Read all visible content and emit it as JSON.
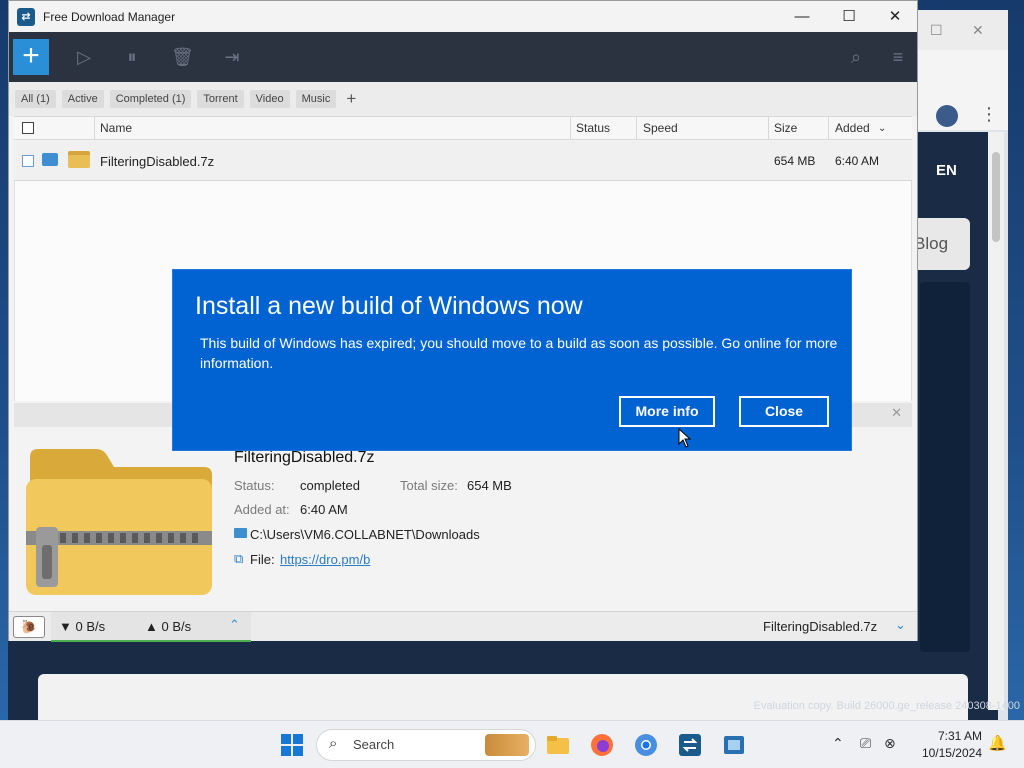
{
  "fdm": {
    "title": "Free Download Manager",
    "filters": [
      "All (1)",
      "Active",
      "Completed (1)",
      "Torrent",
      "Video",
      "Music"
    ],
    "filter_add": "+",
    "columns": {
      "name": "Name",
      "status": "Status",
      "speed": "Speed",
      "size": "Size",
      "added": "Added"
    },
    "download": {
      "name": "FilteringDisabled.7z",
      "size": "654 MB",
      "added": "6:40 AM"
    },
    "detail": {
      "name": "FilteringDisabled.7z",
      "status_label": "Status:",
      "status_value": "completed",
      "total_size_label": "Total size:",
      "total_size_value": "654 MB",
      "added_label": "Added at:",
      "added_value": "6:40 AM",
      "path": "C:\\Users\\VM6.COLLABNET\\Downloads",
      "file_label": "File:",
      "file_link": "https://dro.pm/b"
    },
    "status_bar": {
      "down_speed": "▼ 0 B/s",
      "up_speed": "▲ 0 B/s",
      "current_file": "FilteringDisabled.7z"
    }
  },
  "dialog": {
    "title": "Install a new build of Windows now",
    "body": "This build of Windows has expired; you should move to a build as soon as possible. Go online for more information.",
    "more_info": "More info",
    "close": "Close"
  },
  "background_browser": {
    "lang": "EN",
    "blog": "Blog"
  },
  "watermark": "Evaluation copy. Build 26000.ge_release 240308-1400",
  "taskbar": {
    "search_label": "Search",
    "time": "7:31 AM",
    "date": "10/15/2024"
  },
  "colors": {
    "dialog_bg": "#0063d1",
    "fdm_toolbar": "#2b3341",
    "add_button": "#2a8fd6",
    "link": "#2a7bc4"
  }
}
